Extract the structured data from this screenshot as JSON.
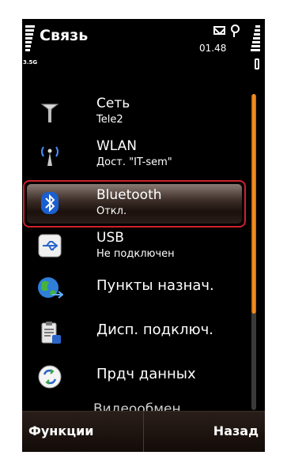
{
  "status": {
    "title": "Связь",
    "time": "01.48",
    "network": "3.5G"
  },
  "items": [
    {
      "title": "Сеть",
      "subtitle": "Tele2"
    },
    {
      "title": "WLAN",
      "subtitle": "Дост. \"IT-sem\""
    },
    {
      "title": "Bluetooth",
      "subtitle": "Откл."
    },
    {
      "title": "USB",
      "subtitle": "Не подключен"
    },
    {
      "title": "Пункты назнач."
    },
    {
      "title": "Дисп. подключ."
    },
    {
      "title": "Прдч данных"
    },
    {
      "title": "Видеообмен"
    }
  ],
  "softkeys": {
    "left": "Функции",
    "right": "Назад"
  },
  "colors": {
    "selection_border": "#d0202c",
    "scroll_thumb": "#ff9a2a"
  }
}
